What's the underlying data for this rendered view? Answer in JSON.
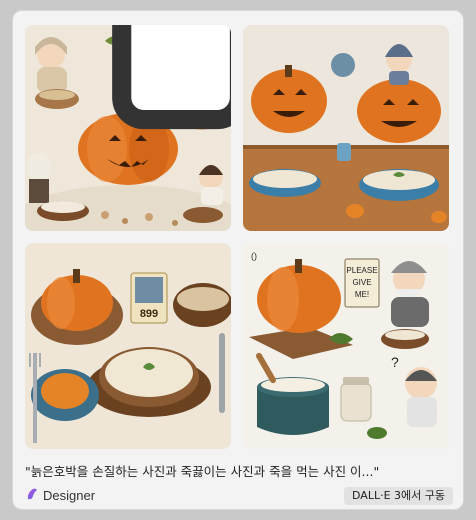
{
  "caption": "\"늙은호박을 손질하는 사진과 죽끓이는 사진과 죽을 먹는 사진 이...\"",
  "brand": {
    "name": "Designer",
    "icon": "designer-logo-icon"
  },
  "model_badge": "DALL·E 3에서 구동",
  "images": [
    {
      "id": 1,
      "scene": "pumpkin-peeling"
    },
    {
      "id": 2,
      "scene": "porridge-cooking"
    },
    {
      "id": 3,
      "scene": "porridge-bowl",
      "card_text": "899"
    },
    {
      "id": 4,
      "scene": "eating-porridge",
      "sign_text": [
        "PLEASE",
        "GIVE",
        "ME!"
      ]
    }
  ],
  "colors": {
    "accent": "#7b3fe4",
    "pumpkin": "#e0731f",
    "background": "#f3f3f3"
  }
}
